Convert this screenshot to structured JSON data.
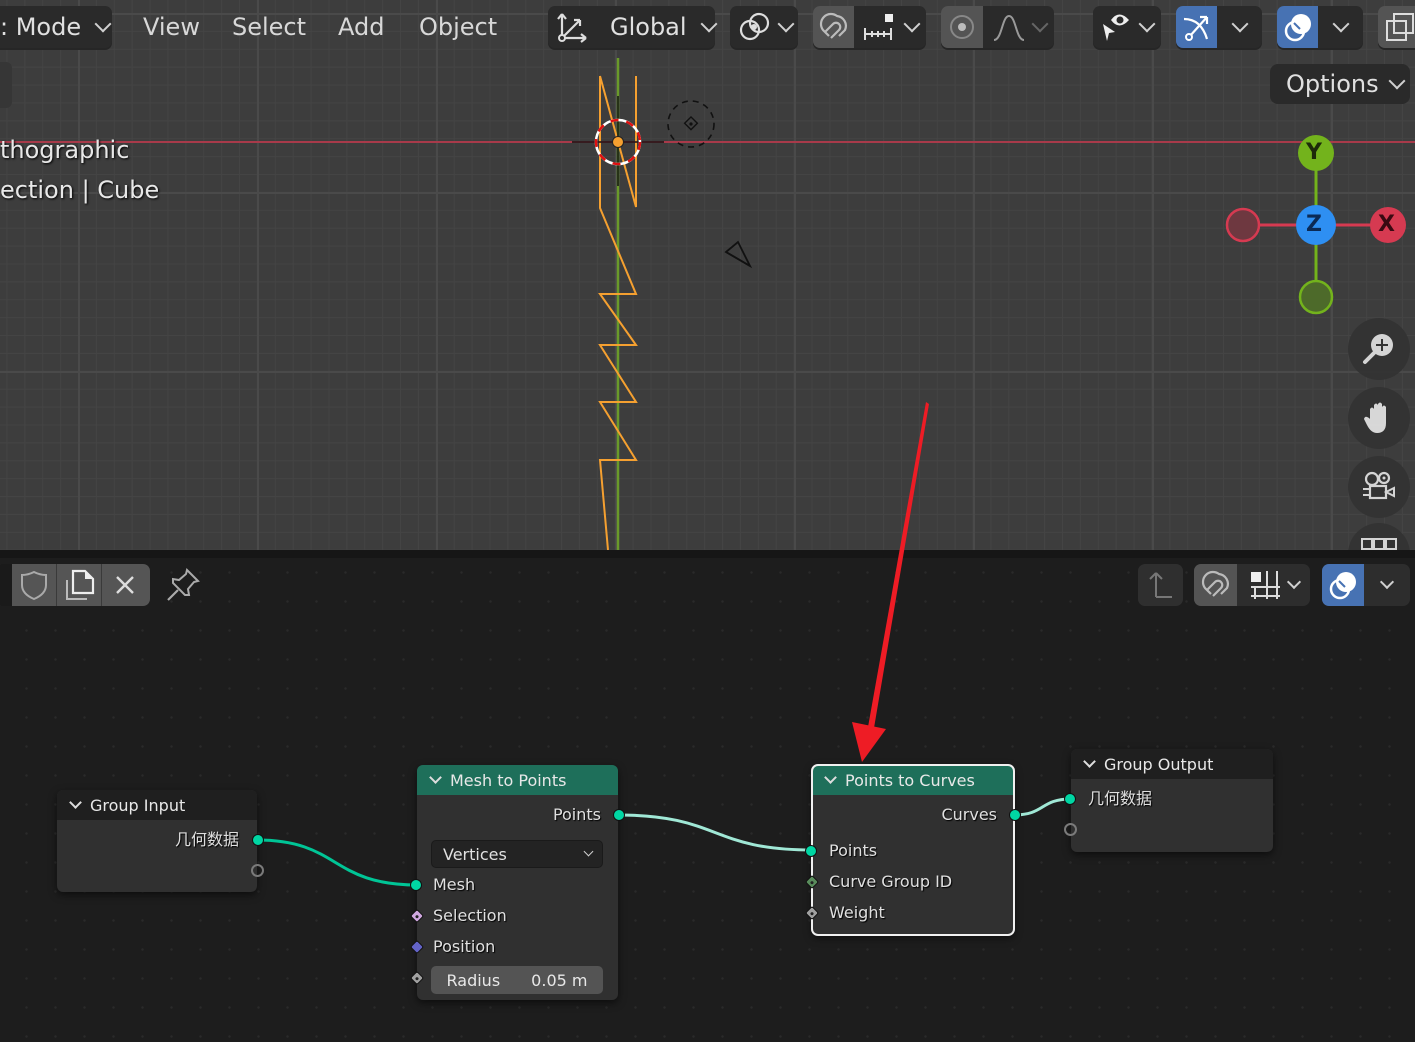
{
  "viewport_header": {
    "mode_selector": {
      "label": ": Mode"
    },
    "menus": [
      "View",
      "Select",
      "Add",
      "Object"
    ],
    "transform_orientation": {
      "label": "Global",
      "icon": "transform-axes-icon"
    },
    "pivot_point": {
      "icon": "pivot-point-icon"
    },
    "snapping": {
      "icon": "magnet-icon",
      "increment_icon": "snap-increment-icon"
    },
    "proportional_editing": {
      "icon": "proportional-edit-icon",
      "falloff_icon": "falloff-curve-icon"
    },
    "visibility": {
      "icon": "selectability-visibility-icon"
    },
    "gizmos": {
      "icon": "gizmo-icon",
      "active": true
    },
    "overlays": {
      "icon": "overlays-icon",
      "active": true
    },
    "xray": {
      "icon": "xray-toggle-icon"
    },
    "options_label": "Options"
  },
  "viewport_overlay_text": {
    "line1": "thographic",
    "line2": "ection | Cube"
  },
  "navigation_gizmo": {
    "axes": {
      "y": "Y",
      "z": "Z",
      "x": "X"
    },
    "colors": {
      "x": "#d63a51",
      "y": "#73b31c",
      "z": "#2e8ff2"
    }
  },
  "nav_buttons": [
    "zoom-icon",
    "hand-pan-icon",
    "camera-view-icon",
    "grid-ortho-icon"
  ],
  "node_editor_header": {
    "buttons_left": [
      "fake-user-shield-icon",
      "duplicate-datablock-icon",
      "unlink-close-icon"
    ],
    "pin_icon": "pin-icon",
    "buttons_right": [
      "parent-node-tree-icon",
      "magnet-icon",
      "snap-grid-icon",
      "overlays-icon"
    ]
  },
  "nodes": {
    "group_input": {
      "title": "Group Input",
      "outputs": [
        "几何数据"
      ]
    },
    "mesh_to_points": {
      "title": "Mesh to Points",
      "output": "Points",
      "mode": "Vertices",
      "inputs": [
        "Mesh",
        "Selection",
        "Position"
      ],
      "radius": {
        "label": "Radius",
        "value": "0.05 m"
      }
    },
    "points_to_curves": {
      "title": "Points to Curves",
      "output": "Curves",
      "inputs": [
        "Points",
        "Curve Group ID",
        "Weight"
      ],
      "selected": true
    },
    "group_output": {
      "title": "Group Output",
      "inputs": [
        "几何数据"
      ]
    }
  },
  "colors": {
    "geometry_socket": "#00d6a3",
    "geometry_header": "#1e6f5a",
    "active_blue": "#4772b3",
    "annotation_arrow": "#ee1c25",
    "curve_orange": "#f5a030"
  },
  "annotation": {
    "type": "arrow",
    "points_to": "Points to Curves"
  }
}
